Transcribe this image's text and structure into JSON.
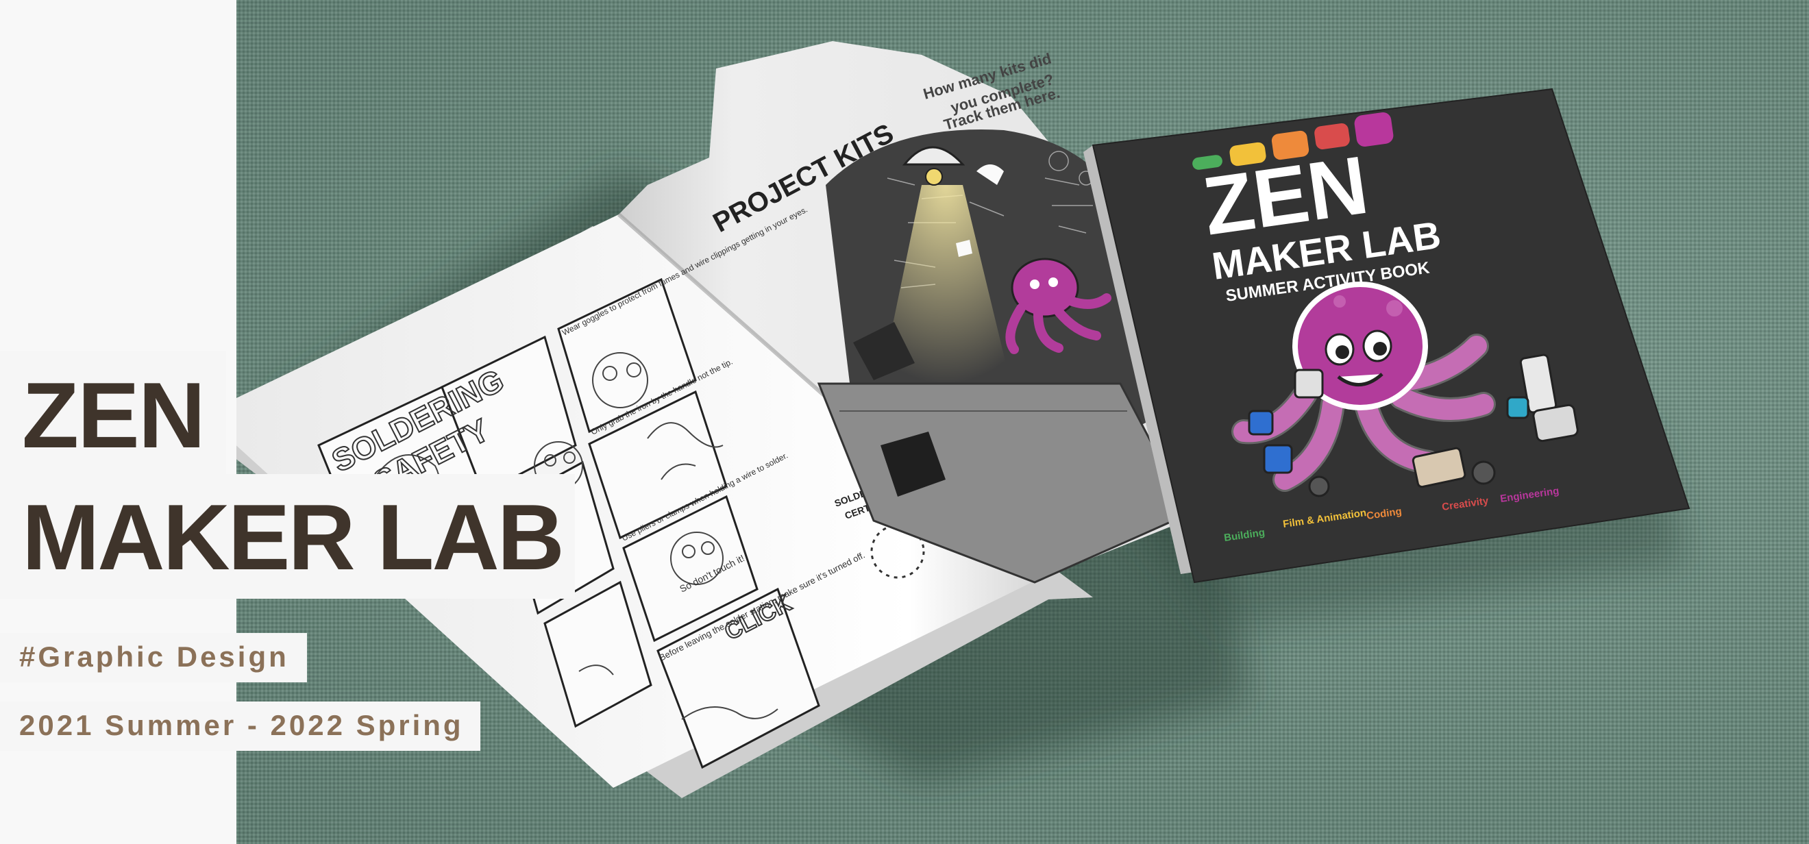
{
  "title": {
    "line1": "ZEN",
    "line2": "MAKER LAB"
  },
  "tags": {
    "category": "#Graphic Design",
    "period": "2021 Summer - 2022 Spring"
  },
  "open_book": {
    "right_page_heading": "PROJECT KITS",
    "right_page_prompt": [
      "How many kits did",
      "you complete?",
      "Track them here."
    ],
    "left_page_title": [
      "SOLDERING",
      "SAFETY"
    ],
    "panel_captions": [
      "Wear goggles to protect from fumes and wire clippings getting in your eyes.",
      "Only grab the iron by the handle not the tip.",
      "Use pliers or clamps when holding a wire to solder.",
      "So don't touch it!",
      "Before leaving the solder station, make sure it's turned off."
    ],
    "sound_effect": "CLICK",
    "badge_label": [
      "SOLDERING",
      "CERTIFIED"
    ]
  },
  "cover": {
    "title_line1": "ZEN",
    "title_line2": "MAKER LAB",
    "subtitle": "SUMMER ACTIVITY BOOK",
    "categories": [
      "Building",
      "Film & Animation",
      "Coding",
      "Creativity",
      "Engineering"
    ]
  },
  "colors": {
    "title_text": "#3f342b",
    "tag_text": "#8b7158",
    "fabric": "#6b8d80",
    "cover_bg": "#333333",
    "octopus": "#b23c9b",
    "tab_green": "#4cae5c",
    "tab_yellow": "#f2c13a",
    "tab_orange": "#ee8a3b",
    "tab_red": "#d94c4c",
    "tab_magenta": "#b8379c"
  }
}
